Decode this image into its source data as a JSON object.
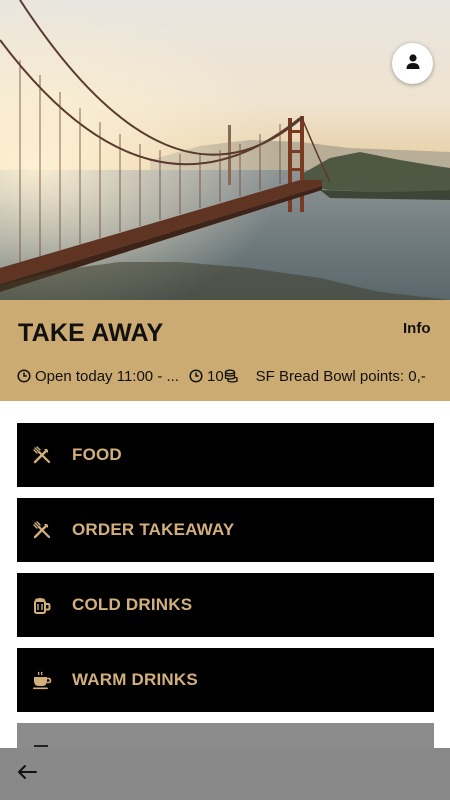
{
  "header": {
    "title": "TAKE AWAY",
    "info_label": "Info",
    "hero_image_name": "golden-gate-bridge-photo"
  },
  "meta": {
    "opening": "Open today 11:00 - ...",
    "prep_time": "10",
    "points": "SF Bread Bowl points: 0,-"
  },
  "menu": {
    "items": [
      {
        "label": "FOOD",
        "icon": "cutlery-icon"
      },
      {
        "label": "ORDER TAKEAWAY",
        "icon": "cutlery-icon"
      },
      {
        "label": "COLD DRINKS",
        "icon": "beer-mug-icon"
      },
      {
        "label": "WARM DRINKS",
        "icon": "coffee-cup-icon"
      }
    ]
  },
  "colors": {
    "band": "#ccab72",
    "button_bg": "#000000",
    "button_text": "#d3b07b",
    "bottom_bar": "#898989"
  }
}
